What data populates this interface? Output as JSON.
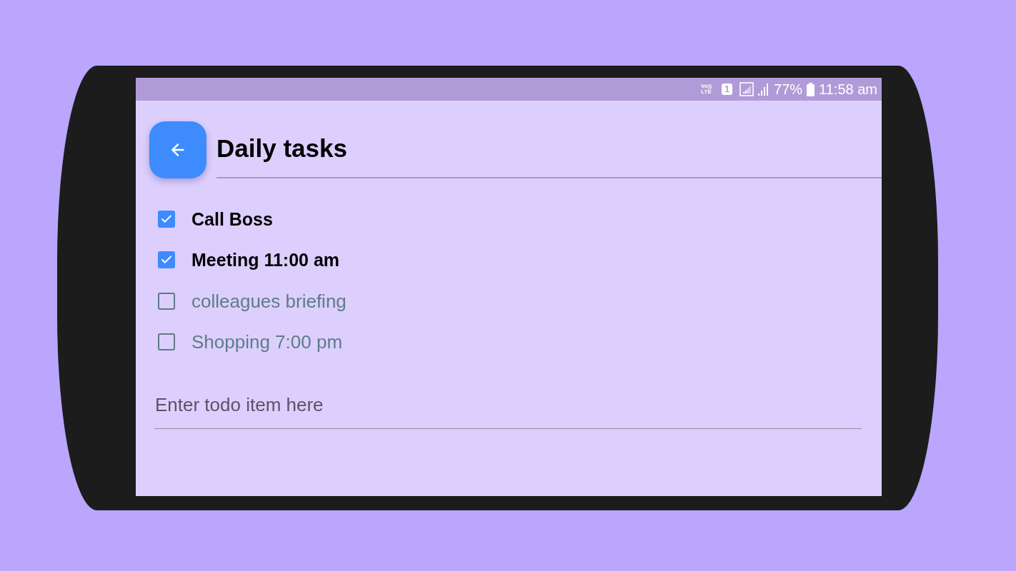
{
  "status_bar": {
    "volte": [
      "Vo))",
      "LTE"
    ],
    "sim_slot": "1",
    "battery_percent": "77%",
    "time": "11:58 am"
  },
  "header": {
    "title": "Daily tasks"
  },
  "tasks": [
    {
      "label": "Call Boss",
      "checked": true
    },
    {
      "label": "Meeting 11:00 am",
      "checked": true
    },
    {
      "label": "colleagues briefing",
      "checked": false
    },
    {
      "label": "Shopping 7:00 pm",
      "checked": false
    }
  ],
  "new_item": {
    "placeholder": "Enter todo item here"
  }
}
